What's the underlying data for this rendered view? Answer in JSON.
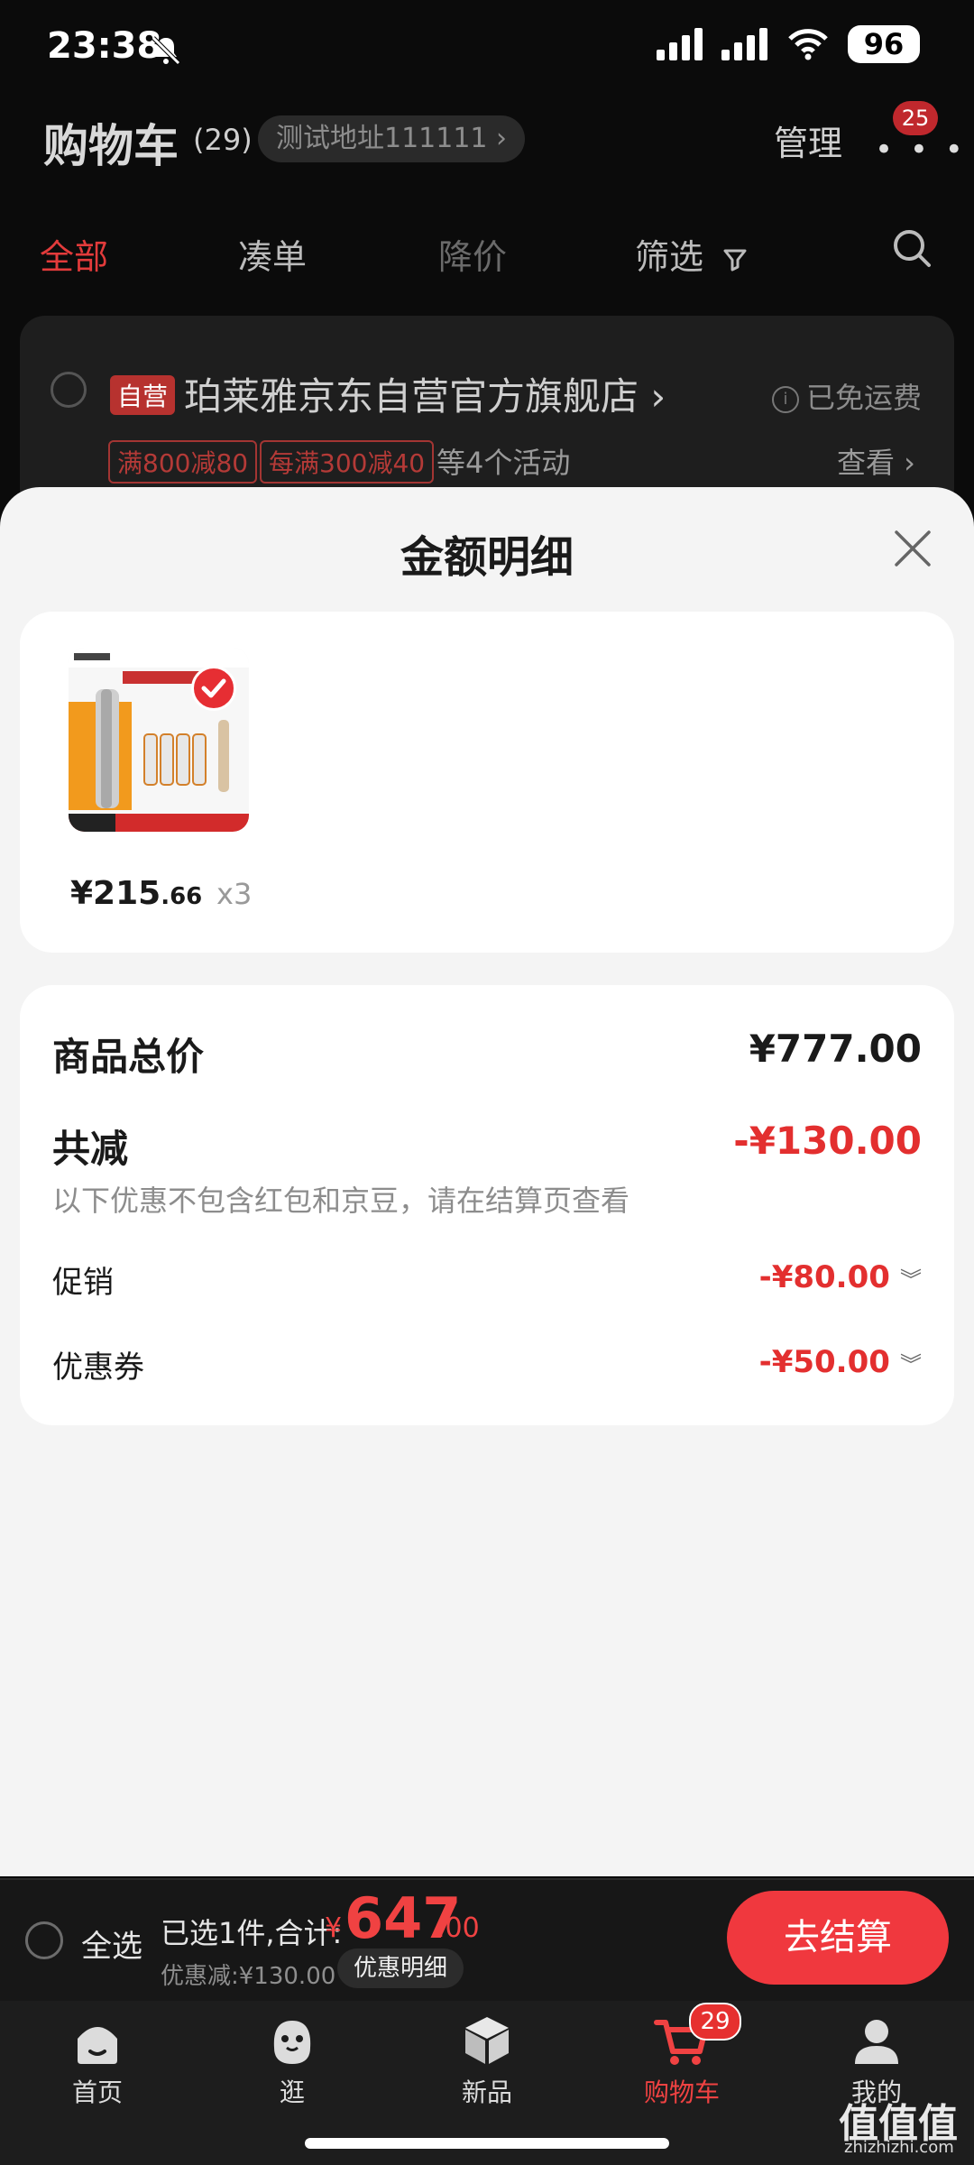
{
  "status_bar": {
    "time": "23:38",
    "battery": "96"
  },
  "header": {
    "title": "购物车",
    "count": "(29)",
    "address": "测试地址111111 ›",
    "manage": "管理",
    "more_badge": "25"
  },
  "tabs": [
    {
      "label": "全部"
    },
    {
      "label": "凑单"
    },
    {
      "label": "降价"
    },
    {
      "label": "筛选"
    }
  ],
  "store": {
    "tag": "自营",
    "name": "珀莱雅京东自营官方旗舰店 ›",
    "shipping": "已免运费",
    "promos": [
      "满800减80",
      "每满300减40"
    ],
    "promo_more": "等4个活动",
    "view": "查看 ›"
  },
  "sheet": {
    "title": "金额明细",
    "product": {
      "price_int": "¥215",
      "price_dec": ".66",
      "qty": "x3"
    },
    "summary": {
      "total_label": "商品总价",
      "total_value": "¥777.00",
      "reduce_label": "共减",
      "reduce_value": "-¥130.00",
      "note": "以下优惠不包含红包和京豆，请在结算页查看",
      "promo_label": "促销",
      "promo_value": "-¥80.00",
      "coupon_label": "优惠券",
      "coupon_value": "-¥50.00"
    }
  },
  "checkout": {
    "select_all": "全选",
    "selected_text": "已选1件,合计:",
    "currency": "¥",
    "total_int": "647",
    "total_dec": ".00",
    "discount_text": "优惠减:¥130.00",
    "detail_button": "优惠明细",
    "submit": "去结算"
  },
  "nav": [
    {
      "label": "首页"
    },
    {
      "label": "逛"
    },
    {
      "label": "新品"
    },
    {
      "label": "购物车",
      "badge": "29"
    },
    {
      "label": "我的"
    }
  ],
  "watermark": {
    "main": "值值值",
    "sub": "zhizhizhi.com"
  },
  "colors": {
    "accent": "#f0383e",
    "sheet_bg": "#f4f4f4",
    "dark_bg": "#0b0b0b"
  }
}
